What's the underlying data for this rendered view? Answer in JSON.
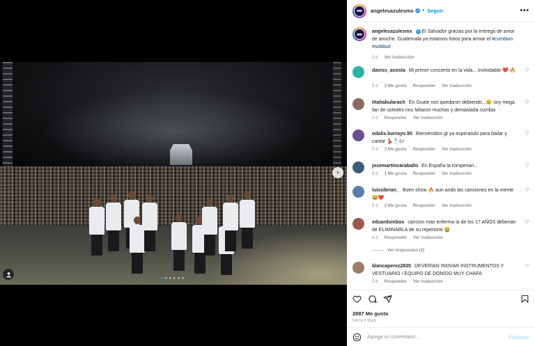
{
  "post": {
    "username": "angelesazulesmx",
    "separator": "•",
    "follow_label": "Seguir",
    "more_label": "•••",
    "media": {
      "current_slide": 1,
      "total_slides": 6
    }
  },
  "caption": {
    "username": "angelesazulesmx",
    "text": "El Salvador gracias por la entrega de amor de anoche. Guatemala ya estamos listos para armar el",
    "hashtags": [
      "#cumbion",
      "#soldout"
    ],
    "time": "5 d",
    "translate_label": "Ver traducción"
  },
  "comments": [
    {
      "username": "daviss_acosta",
      "text": "Mi primer concierto en la vida... inolvidable ❤️ 🔥",
      "time": "5 d",
      "likes": "3 Me gusta",
      "reply_label": "Responder",
      "translate_label": "Ver traducción",
      "avatar_color": "#2bb3a6"
    },
    {
      "username": "titahabularach",
      "text": "En Guate nos quedaron debiendo...😢 soy mega fan de ustedes nos faltaron muchas y demasiada cumbia",
      "time": "3 d",
      "likes": "",
      "reply_label": "Responder",
      "translate_label": "Ver traducción",
      "avatar_color": "#8c6b5a"
    },
    {
      "username": "odalis.borrayo.90",
      "text": "Bienvenidos gt ya esperando para bailar y cantar 💃🕺🎶",
      "time": "5 d",
      "likes": "3 Me gusta",
      "reply_label": "Responder",
      "translate_label": "Ver traducción",
      "avatar_color": "#6a4f8f"
    },
    {
      "username": "josemartincaraballo",
      "text": "En España la romperian...",
      "time": "5 d",
      "likes": "1 Me gusta",
      "reply_label": "Responder",
      "translate_label": "Ver traducción",
      "avatar_color": "#3b5b7a"
    },
    {
      "username": "luissibrian_",
      "text": "Buen show 🔥 aun ando las canciones en la mente 😂❤️",
      "time": "5 d",
      "likes": "2 Me gusta",
      "reply_label": "Responder",
      "translate_label": "Ver traducción",
      "avatar_color": "#5a7fa8"
    },
    {
      "username": "eduardoinbox",
      "text": "cancion mas enferma la de los 17 AÑOS deberian de ELIMINARLA de su repertorio 🤮",
      "time": "4 d",
      "likes": "",
      "reply_label": "Responder",
      "translate_label": "Ver traducción",
      "avatar_color": "#a0584a",
      "view_replies_label": "Ver respuestas (2)"
    },
    {
      "username": "blancaperez2835",
      "text": "DEVERIAN INOVAR INSTRUMENTOS Y VESTUARIO ! EQUIPO DE DONIDO MUY CHAFA",
      "time": "5 d",
      "likes": "",
      "reply_label": "Responder",
      "translate_label": "Ver traducción",
      "avatar_color": "#9b7d6a"
    }
  ],
  "actions": {
    "likes_count": "2887 Me gusta",
    "posted_ago": "HACE 5 DÍAS"
  },
  "add_comment": {
    "placeholder": "Agrega un comentario...",
    "publish_label": "Publicar"
  },
  "colors": {
    "accent": "#0095f6",
    "link": "#00376b",
    "muted": "#8e8e8e",
    "heart": "#e02424"
  },
  "icons": {
    "like": "heart-outline-icon",
    "comment": "comment-bubble-icon",
    "share": "paper-plane-icon",
    "save": "bookmark-icon",
    "emoji": "smiley-icon",
    "next": "chevron-right-icon",
    "tag": "person-tag-icon"
  }
}
